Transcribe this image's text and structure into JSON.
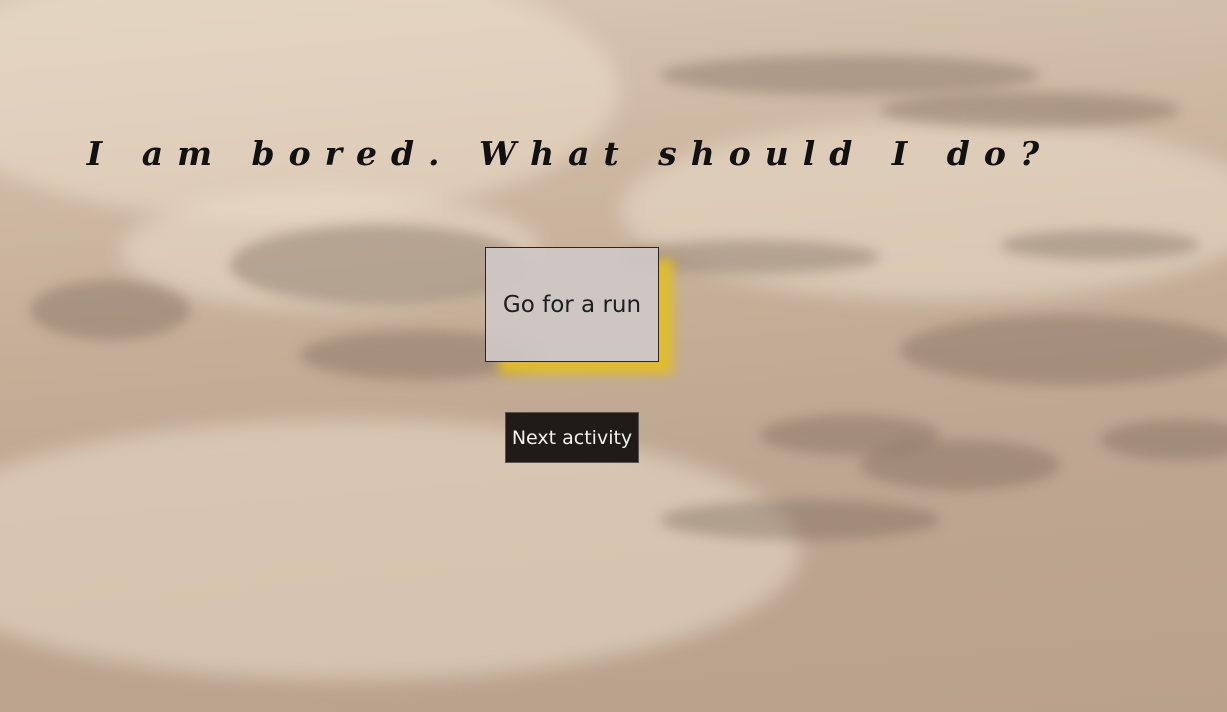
{
  "header": {
    "title": "I am bored. What should I do?"
  },
  "activity": {
    "text": "Go for a run"
  },
  "controls": {
    "next_label": "Next activity"
  },
  "background": {
    "description_icon": "desert-dunes-image",
    "sand_color": "#c9b39c",
    "accent_shadow_color": "#e2be28"
  }
}
